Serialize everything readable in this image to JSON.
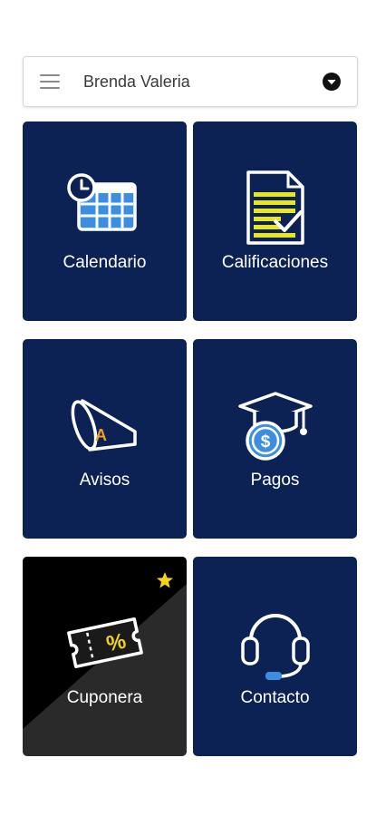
{
  "header": {
    "user_name": "Brenda Valeria",
    "menu_icon": "hamburger-menu-icon",
    "dropdown_icon": "chevron-down-circle-icon"
  },
  "tiles": [
    {
      "label": "Calendario",
      "icon": "calendar-clock-icon"
    },
    {
      "label": "Calificaciones",
      "icon": "grades-document-icon"
    },
    {
      "label": "Avisos",
      "icon": "megaphone-icon"
    },
    {
      "label": "Pagos",
      "icon": "graduation-cap-dollar-icon"
    },
    {
      "label": "Cuponera",
      "icon": "coupon-ticket-icon",
      "badge_icon": "star-icon"
    },
    {
      "label": "Contacto",
      "icon": "headset-icon"
    }
  ],
  "colors": {
    "tile_background": "#0c2255",
    "coupon_dark": "#000000",
    "coupon_light": "#2a2a2a",
    "accent_yellow": "#f2d21b",
    "icon_blue": "#3c8fe0",
    "icon_orange": "#f0a020",
    "white": "#ffffff"
  }
}
